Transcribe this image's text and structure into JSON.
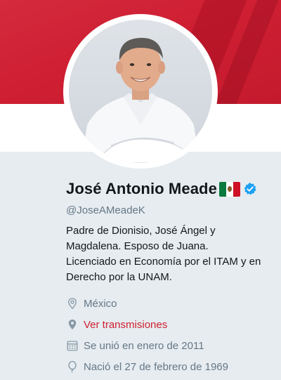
{
  "profile": {
    "name": "José Antonio Meade",
    "handle": "@JoseAMeadeK",
    "bio_lines": [
      "Padre de Dionisio, José Ángel y",
      "Magdalena. Esposo de Juana.",
      "Licenciado en Economía por el ITAM y en",
      "Derecho por la UNAM."
    ],
    "location": "México",
    "website": "Ver transmisiones",
    "joined": "Se unió en enero de 2011",
    "born": "Nació el 27 de febrero de 1969"
  },
  "icons": {
    "flag": "mexico-flag-emoji",
    "verified": "verified-badge-icon",
    "location": "location-pin-icon",
    "website": "map-marker-icon",
    "joined": "calendar-icon",
    "born": "balloon-icon"
  },
  "colors": {
    "banner": "#cf1f33",
    "background": "#e6ecf0",
    "link": "#cf2030",
    "secondary_text": "#657786",
    "verified": "#1da1f2"
  }
}
